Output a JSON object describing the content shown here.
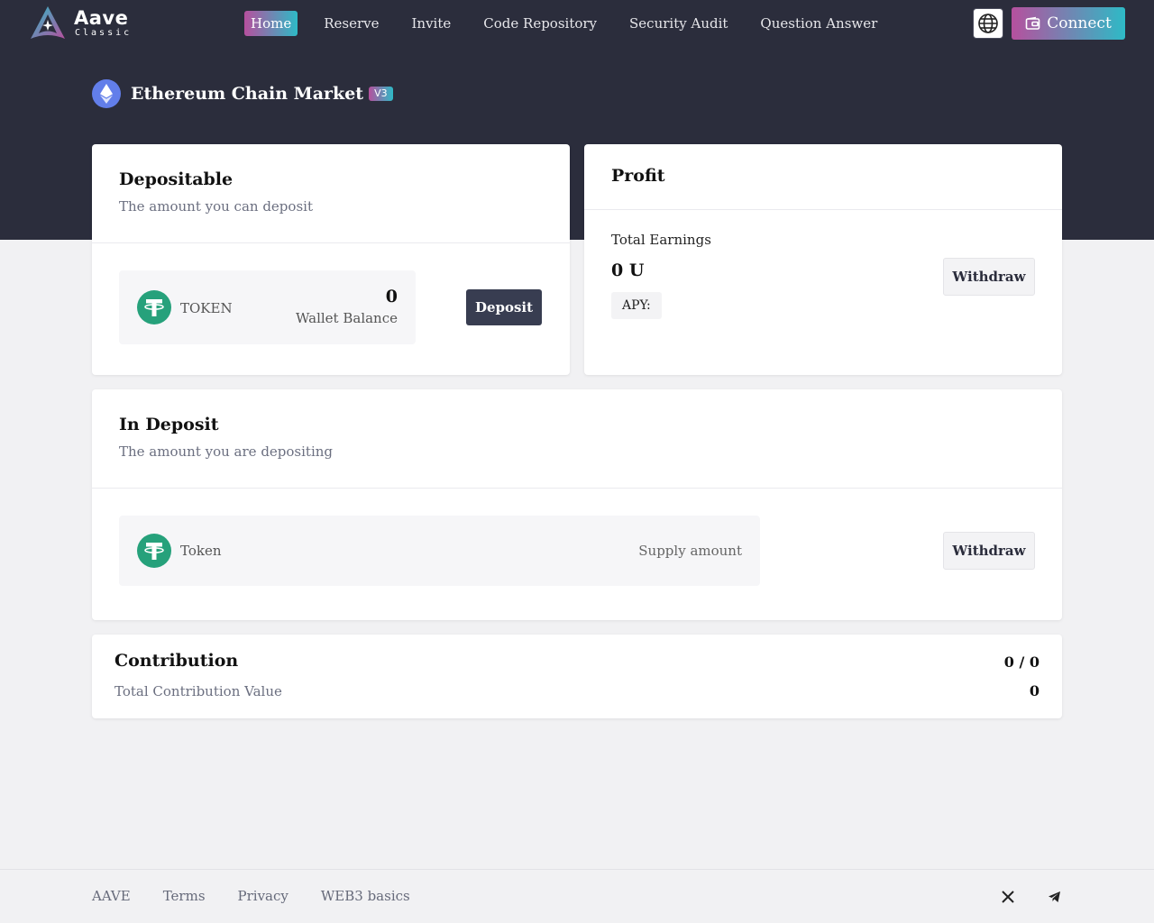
{
  "brand": {
    "name": "Aave",
    "subtitle": "Classic"
  },
  "nav": {
    "items": [
      {
        "label": "Home",
        "active": true
      },
      {
        "label": "Reserve"
      },
      {
        "label": "Invite"
      },
      {
        "label": "Code Repository"
      },
      {
        "label": "Security Audit"
      },
      {
        "label": "Question Answer"
      }
    ]
  },
  "header": {
    "language_icon": "globe-icon",
    "connect_label": "Connect",
    "connect_icon": "wallet-icon"
  },
  "market": {
    "title": "Ethereum Chain Market",
    "version": "V3",
    "icon": "ethereum-icon"
  },
  "depositable": {
    "title": "Depositable",
    "subtitle": "The amount you can deposit",
    "token_label": "TOKEN",
    "balance": "0",
    "balance_label": "Wallet Balance",
    "deposit_label": "Deposit",
    "token_icon": "tether-icon"
  },
  "profit": {
    "title": "Profit",
    "earnings_label": "Total Earnings",
    "earnings_value": "0 U",
    "apy_label": "APY:",
    "withdraw_label": "Withdraw"
  },
  "in_deposit": {
    "title": "In Deposit",
    "subtitle": "The amount you are depositing",
    "token_label": "Token",
    "supply_label": "Supply amount",
    "withdraw_label": "Withdraw",
    "token_icon": "tether-icon"
  },
  "contribution": {
    "title": "Contribution",
    "subtitle": "Total Contribution Value",
    "ratio": "0 / 0",
    "value": "0"
  },
  "footer": {
    "links": [
      "AAVE",
      "Terms",
      "Privacy",
      "WEB3 basics"
    ],
    "social": [
      "x-icon",
      "telegram-icon"
    ]
  },
  "colors": {
    "header_bg": "#2b2d3c",
    "accent_start": "#b6509e",
    "accent_end": "#2ebac6",
    "tether_green": "#26a17b"
  }
}
